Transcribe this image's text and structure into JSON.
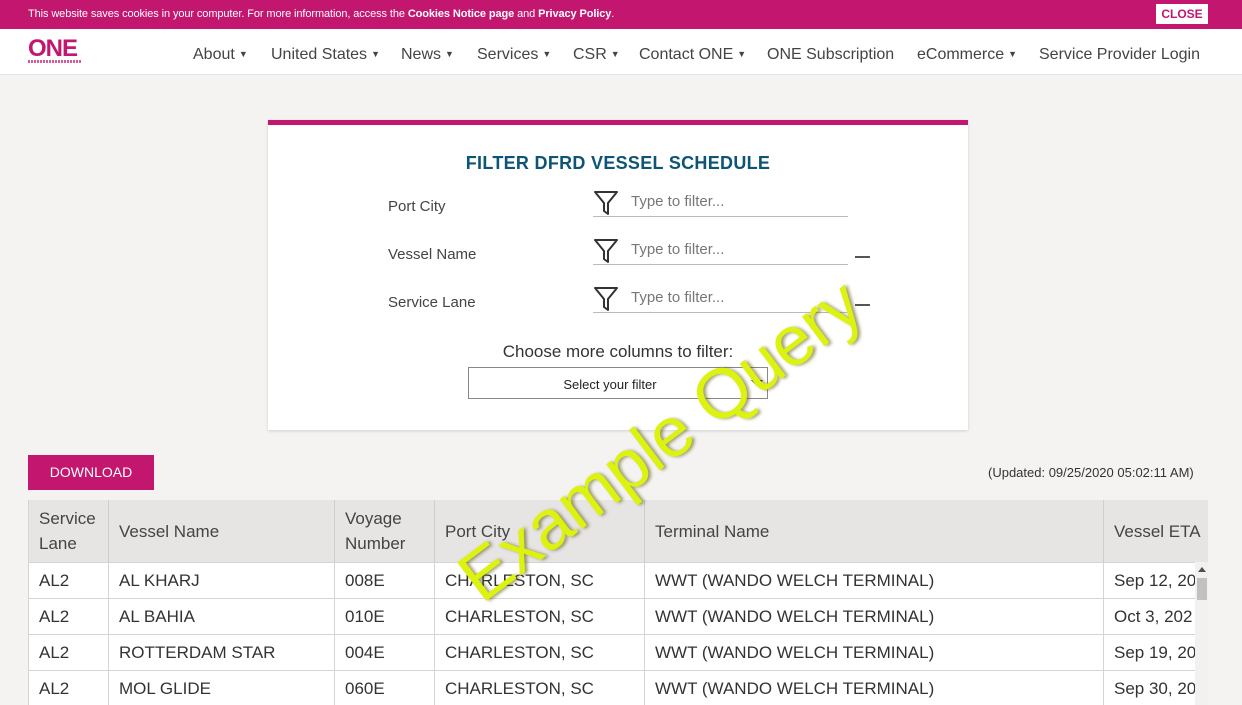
{
  "cookie": {
    "text_prefix": "This website saves cookies in your computer. For more information, access the ",
    "link1": "Cookies Notice page",
    "text_mid": " and ",
    "link2": "Privacy Policy",
    "text_suffix": ".",
    "close_label": "CLOSE"
  },
  "nav": {
    "logo": "ONE",
    "items": [
      {
        "label": "About",
        "dropdown": true
      },
      {
        "label": "United States",
        "dropdown": true
      },
      {
        "label": "News",
        "dropdown": true
      },
      {
        "label": "Services",
        "dropdown": true
      },
      {
        "label": "CSR",
        "dropdown": true
      },
      {
        "label": "Contact ONE",
        "dropdown": true
      },
      {
        "label": "ONE Subscription",
        "dropdown": false
      },
      {
        "label": "eCommerce",
        "dropdown": true
      },
      {
        "label": "Service Provider Login",
        "dropdown": false
      }
    ],
    "caret": "▼"
  },
  "filter": {
    "title": "FILTER DFRD VESSEL SCHEDULE",
    "fields": [
      {
        "label": "Port City",
        "placeholder": "Type to filter..."
      },
      {
        "label": "Vessel Name",
        "placeholder": "Type to filter..."
      },
      {
        "label": "Service Lane",
        "placeholder": "Type to filter..."
      }
    ],
    "more_label": "Choose more columns to filter:",
    "select_value": "Select your filter"
  },
  "download_label": "DOWNLOAD",
  "updated_text": "(Updated: 09/25/2020 05:02:11 AM)",
  "table": {
    "headers": [
      "Service Lane",
      "Vessel Name",
      "Voyage Number",
      "Port City",
      "Terminal Name",
      "Vessel ETA"
    ],
    "rows": [
      [
        "AL2",
        "AL KHARJ",
        "008E",
        "CHARLESTON, SC",
        "WWT (WANDO WELCH TERMINAL)",
        "Sep 12, 20"
      ],
      [
        "AL2",
        "AL BAHIA",
        "010E",
        "CHARLESTON, SC",
        "WWT (WANDO WELCH TERMINAL)",
        "Oct 3, 202"
      ],
      [
        "AL2",
        "ROTTERDAM STAR",
        "004E",
        "CHARLESTON, SC",
        "WWT (WANDO WELCH TERMINAL)",
        "Sep 19, 20"
      ],
      [
        "AL2",
        "MOL GLIDE",
        "060E",
        "CHARLESTON, SC",
        "WWT (WANDO WELCH TERMINAL)",
        "Sep 30, 20"
      ]
    ]
  },
  "watermark": "Example Query",
  "colors": {
    "brand": "#c2166f",
    "title": "#0e5477",
    "watermark": "#dcf20f"
  }
}
